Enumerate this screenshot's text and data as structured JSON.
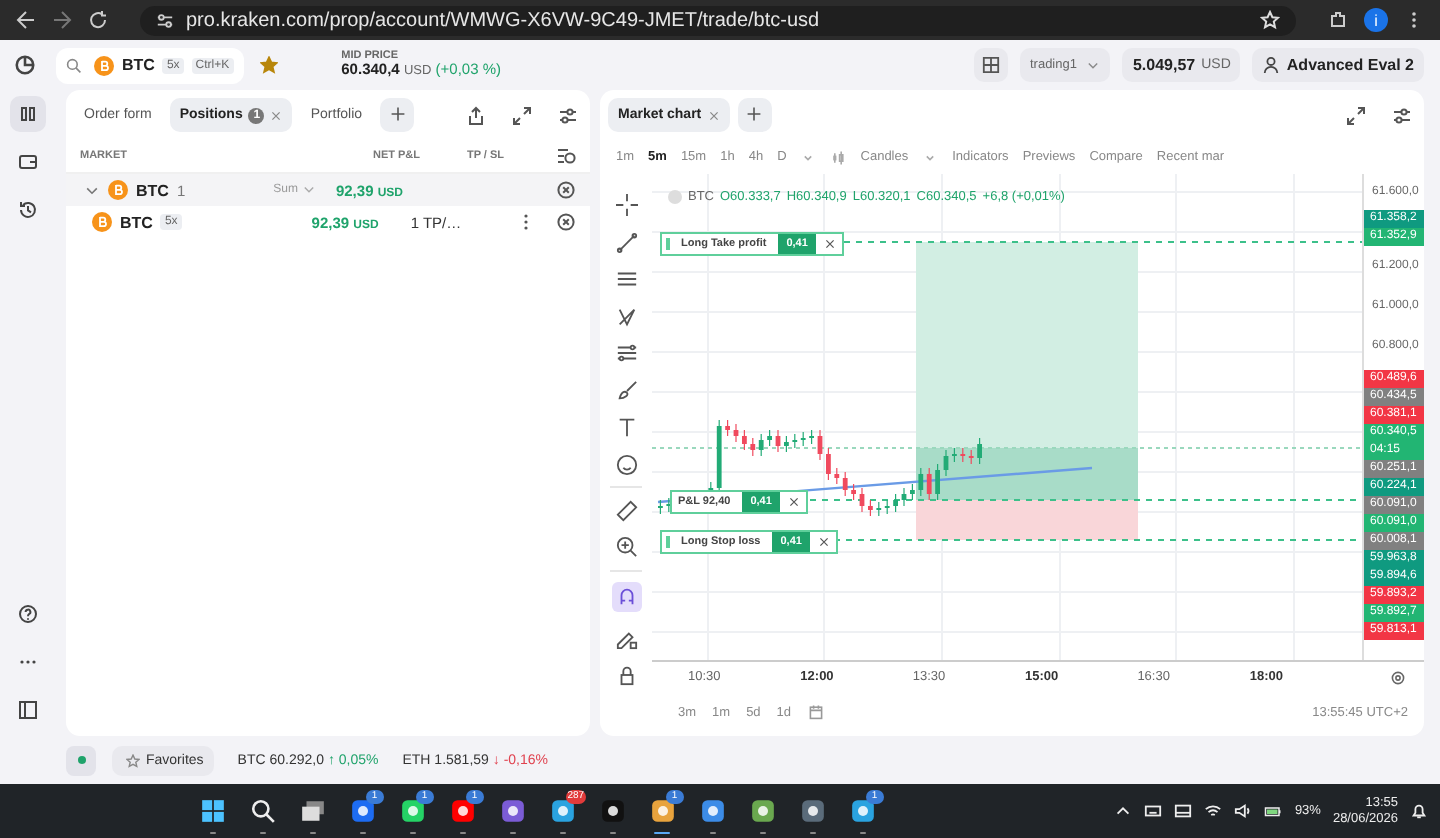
{
  "browser": {
    "url": "pro.kraken.com/prop/account/WMWG-X6VW-9C49-JMET/trade/btc-usd",
    "profile": "i"
  },
  "header": {
    "symbol": "BTC",
    "leverage": "5x",
    "shortcut": "Ctrl+K",
    "favorite": true,
    "mid_price_label": "MID PRICE",
    "mid_price": "60.340,4",
    "mid_price_unit": "USD",
    "mid_price_change": "(+0,03 %)",
    "account": "trading1",
    "balance": "5.049,57",
    "balance_unit": "USD",
    "profile": "Advanced Eval 2"
  },
  "panel_tabs": [
    {
      "label": "Order form",
      "selected": false
    },
    {
      "label": "Positions",
      "count": "1",
      "selected": true
    },
    {
      "label": "Portfolio",
      "selected": false
    }
  ],
  "positions": {
    "columns": [
      "MARKET",
      "NET P&L",
      "TP / SL"
    ],
    "rows": [
      {
        "kind": "group",
        "symbol": "BTC",
        "count": "1",
        "aggregate": "Sum",
        "pnl": "92,39",
        "unit": "USD",
        "expanded": true
      },
      {
        "kind": "position",
        "symbol": "BTC",
        "leverage": "5x",
        "pnl": "92,39",
        "unit": "USD",
        "tp_sl": "1 TP/…"
      }
    ]
  },
  "chart": {
    "tab": "Market chart",
    "timeframes": [
      {
        "label": "1m",
        "selected": false
      },
      {
        "label": "5m",
        "selected": true
      },
      {
        "label": "15m",
        "selected": false
      },
      {
        "label": "1h",
        "selected": false
      },
      {
        "label": "4h",
        "selected": false
      },
      {
        "label": "D",
        "selected": false
      }
    ],
    "chart_type": "Candles",
    "tools": [
      "Indicators",
      "Previews",
      "Compare",
      "Recent mar"
    ],
    "ohlc": {
      "symbol": "BTC",
      "values": [
        "O60.333,7",
        "H60.340,9",
        "L60.320,1",
        "C60.340,5",
        "+6,8 (+0,01%)"
      ]
    },
    "orders": [
      {
        "kind": "take_profit",
        "label": "Long Take profit",
        "qty": "0,41"
      },
      {
        "kind": "pnl",
        "label": "P&L 92,40",
        "qty": "0,41"
      },
      {
        "kind": "stop_loss",
        "label": "Long Stop loss",
        "qty": "0,41"
      }
    ],
    "price_axis": [
      {
        "kind": "tick",
        "text": "61.600,0"
      },
      {
        "kind": "tag",
        "text": "61.358,2",
        "color": "#0f9a80"
      },
      {
        "kind": "tag",
        "text": "61.352,9",
        "color": "#22b573"
      },
      {
        "kind": "tick",
        "text": "61.200,0"
      },
      {
        "kind": "tick",
        "text": "61.000,0"
      },
      {
        "kind": "tick",
        "text": "60.800,0"
      },
      {
        "kind": "tag",
        "text": "60.489,6",
        "color": "#f23645"
      },
      {
        "kind": "tag",
        "text": "60.434,5",
        "color": "#808080"
      },
      {
        "kind": "tag",
        "text": "60.381,1",
        "color": "#f23645"
      },
      {
        "kind": "tag",
        "text": "60.340,5",
        "sub": "04:15",
        "color": "#22b573"
      },
      {
        "kind": "tag",
        "text": "60.251,1",
        "color": "#808080"
      },
      {
        "kind": "tag",
        "text": "60.224,1",
        "color": "#0f9a80"
      },
      {
        "kind": "tag",
        "text": "60.091,0",
        "color": "#808080"
      },
      {
        "kind": "tag",
        "text": "60.091,0",
        "color": "#22b573"
      },
      {
        "kind": "tag",
        "text": "60.008,1",
        "color": "#808080"
      },
      {
        "kind": "tag",
        "text": "59.963,8",
        "color": "#0f9a80"
      },
      {
        "kind": "tag",
        "text": "59.894,6",
        "color": "#0f9a80"
      },
      {
        "kind": "tag",
        "text": "59.893,2",
        "color": "#f23645"
      },
      {
        "kind": "tag",
        "text": "59.892,7",
        "color": "#22b573"
      },
      {
        "kind": "tag",
        "text": "59.813,1",
        "color": "#f23645"
      }
    ],
    "time_axis": [
      {
        "label": "10:30",
        "major": false
      },
      {
        "label": "12:00",
        "major": true
      },
      {
        "label": "13:30",
        "major": false
      },
      {
        "label": "15:00",
        "major": true
      },
      {
        "label": "16:30",
        "major": false
      },
      {
        "label": "18:00",
        "major": true
      }
    ],
    "ranges": [
      "3m",
      "1m",
      "5d",
      "1d"
    ],
    "clock": "13:55:45 UTC+2"
  },
  "status_bar": {
    "favorites": "Favorites",
    "tickers": [
      {
        "symbol": "BTC",
        "price": "60.292,0",
        "arrow": "↑",
        "color": "#1fa36b",
        "change": "0,05%"
      },
      {
        "symbol": "ETH",
        "price": "1.581,59",
        "arrow": "↓",
        "color": "#e0424f",
        "change": "-0,16%"
      }
    ]
  },
  "taskbar": {
    "apps": [
      {
        "kind": "start",
        "active": false
      },
      {
        "kind": "search",
        "active": false
      },
      {
        "kind": "taskview",
        "active": false
      },
      {
        "kind": "blue",
        "badge": "1",
        "active": false
      },
      {
        "kind": "green",
        "badge": "1",
        "active": false
      },
      {
        "kind": "red",
        "badge": "1",
        "active": false
      },
      {
        "kind": "purple",
        "active": false
      },
      {
        "kind": "sky",
        "badge": "287",
        "active": false
      },
      {
        "kind": "dark",
        "active": false
      },
      {
        "kind": "chrome",
        "badge": "1",
        "active": true
      },
      {
        "kind": "mail",
        "active": false
      },
      {
        "kind": "chess",
        "active": false
      },
      {
        "kind": "calc",
        "active": false
      },
      {
        "kind": "sky",
        "badge": "1",
        "active": false
      }
    ],
    "battery": "93%",
    "time": "13:55",
    "date": "28/06/2026"
  }
}
